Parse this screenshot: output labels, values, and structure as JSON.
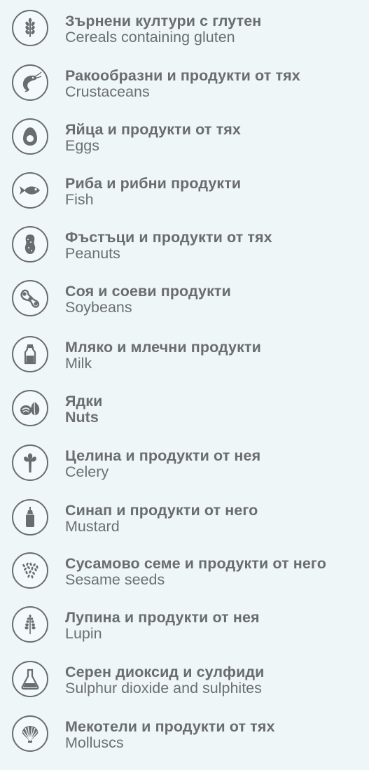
{
  "allergens": [
    {
      "bg": "Зърнени култури с глутен",
      "en": "Cereals containing gluten",
      "icon": "wheat-icon"
    },
    {
      "bg": "Ракообразни и продукти от тях",
      "en": "Crustaceans",
      "icon": "shrimp-icon"
    },
    {
      "bg": "Яйца и продукти от тях",
      "en": "Eggs",
      "icon": "egg-icon"
    },
    {
      "bg": "Риба и рибни продукти",
      "en": "Fish",
      "icon": "fish-icon"
    },
    {
      "bg": "Фъстъци и продукти от тях",
      "en": "Peanuts",
      "icon": "peanut-icon"
    },
    {
      "bg": "Соя и соеви продукти",
      "en": "Soybeans",
      "icon": "soybean-icon"
    },
    {
      "bg": "Мляко и млечни продукти",
      "en": "Milk",
      "icon": "milk-bottle-icon"
    },
    {
      "bg": "Ядки",
      "en": "Nuts",
      "icon": "nuts-icon"
    },
    {
      "bg": "Целина и продукти от нея",
      "en": "Celery",
      "icon": "celery-icon"
    },
    {
      "bg": "Синап и продукти от него",
      "en": "Mustard",
      "icon": "mustard-bottle-icon"
    },
    {
      "bg": "Сусамово семе и продукти от него",
      "en": "Sesame seeds",
      "icon": "sesame-seeds-icon"
    },
    {
      "bg": "Лупина и продукти от нея",
      "en": "Lupin",
      "icon": "lupin-icon"
    },
    {
      "bg": "Серен диоксид и сулфиди",
      "en": "Sulphur dioxide and sulphites",
      "icon": "flask-icon"
    },
    {
      "bg": "Мекотели и продукти от тях",
      "en": "Molluscs",
      "icon": "shell-icon"
    }
  ]
}
